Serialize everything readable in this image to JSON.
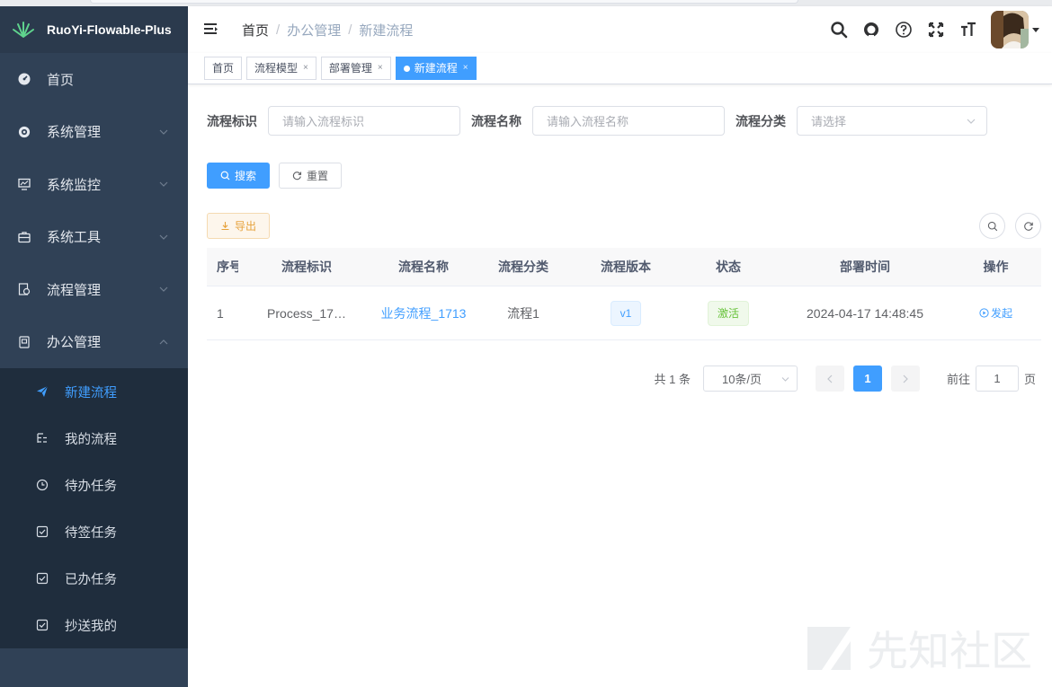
{
  "app": {
    "title": "RuoYi-Flowable-Plus"
  },
  "sidebar": {
    "items": [
      {
        "label": "首页",
        "icon": "dashboard-icon"
      },
      {
        "label": "系统管理",
        "icon": "gear-icon"
      },
      {
        "label": "系统监控",
        "icon": "monitor-icon"
      },
      {
        "label": "系统工具",
        "icon": "toolbox-icon"
      },
      {
        "label": "流程管理",
        "icon": "flow-icon"
      },
      {
        "label": "办公管理",
        "icon": "office-icon"
      }
    ],
    "submenu": [
      {
        "label": "新建流程",
        "icon": "send-icon"
      },
      {
        "label": "我的流程",
        "icon": "list-icon"
      },
      {
        "label": "待办任务",
        "icon": "todo-icon"
      },
      {
        "label": "待签任务",
        "icon": "checkbox-icon"
      },
      {
        "label": "已办任务",
        "icon": "checkbox-icon"
      },
      {
        "label": "抄送我的",
        "icon": "checkbox-icon"
      }
    ]
  },
  "breadcrumb": [
    "首页",
    "办公管理",
    "新建流程"
  ],
  "tags": [
    {
      "label": "首页"
    },
    {
      "label": "流程模型",
      "close": "×"
    },
    {
      "label": "部署管理",
      "close": "×"
    },
    {
      "label": "新建流程",
      "close": "×"
    }
  ],
  "search": {
    "key_label": "流程标识",
    "key_placeholder": "请输入流程标识",
    "name_label": "流程名称",
    "name_placeholder": "请输入流程名称",
    "category_label": "流程分类",
    "category_placeholder": "请选择",
    "search_button": "搜索",
    "reset_button": "重置"
  },
  "toolbar": {
    "export_button": "导出"
  },
  "table": {
    "columns": [
      "序号",
      "流程标识",
      "流程名称",
      "流程分类",
      "流程版本",
      "状态",
      "部署时间",
      "操作"
    ],
    "rows": [
      {
        "index": "1",
        "key": "Process_17…",
        "name": "业务流程_1713",
        "category": "流程1",
        "version": "v1",
        "status": "激活",
        "deploy_time": "2024-04-17 14:48:45",
        "action": "发起"
      }
    ]
  },
  "pagination": {
    "total": "共 1 条",
    "page_size": "10条/页",
    "current_page": "1",
    "goto_label": "前往",
    "goto_value": "1",
    "page_suffix": "页"
  },
  "watermark": {
    "text": "先知社区"
  },
  "colors": {
    "primary": "#409eff",
    "sidebar_bg": "#304156",
    "submenu_bg": "#1f2d3d",
    "success": "#67c23a",
    "warning": "#e6a23c"
  }
}
